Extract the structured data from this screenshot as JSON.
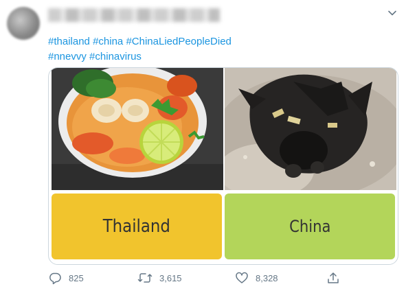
{
  "tweet": {
    "hashtags_line1": [
      "#thailand",
      "#china",
      "#ChinaLiedPeopleDied"
    ],
    "hashtags_line2": [
      "#nnevvy",
      "#chinavirus"
    ]
  },
  "card": {
    "left_label": "Thailand",
    "right_label": "China",
    "left_color": "#f1c42d",
    "right_color": "#b3d55a"
  },
  "actions": {
    "reply_count": "825",
    "retweet_count": "3,615",
    "like_count": "8,328",
    "reply_icon": "reply-icon",
    "retweet_icon": "retweet-icon",
    "like_icon": "heart-icon",
    "share_icon": "share-icon"
  },
  "colors": {
    "link": "#1b95e0",
    "muted": "#657786"
  }
}
